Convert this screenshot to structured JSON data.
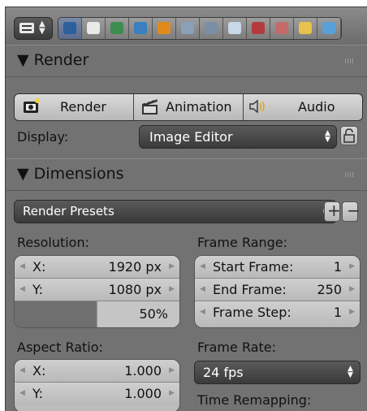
{
  "header": {
    "editor_type_icon": "properties-editor-icon",
    "context_buttons": [
      {
        "icon": "render-camera-icon",
        "active": true,
        "color": "#2d5f9a"
      },
      {
        "icon": "render-layers-icon",
        "active": false,
        "color": "#e9e9e9"
      },
      {
        "icon": "scene-icon",
        "active": false,
        "color": "#3c8d4f"
      },
      {
        "icon": "world-icon",
        "active": false,
        "color": "#3a7fc0"
      },
      {
        "icon": "object-icon",
        "active": false,
        "color": "#e08a1d"
      },
      {
        "icon": "constraints-icon",
        "active": false,
        "color": "#8aa0b8"
      },
      {
        "icon": "modifiers-wrench-icon",
        "active": false,
        "color": "#7a8fa6"
      },
      {
        "icon": "object-data-icon",
        "active": false,
        "color": "#c9d7e6"
      },
      {
        "icon": "material-icon",
        "active": false,
        "color": "#b33b3b"
      },
      {
        "icon": "texture-icon",
        "active": false,
        "color": "#c46a6a"
      },
      {
        "icon": "particles-icon",
        "active": false,
        "color": "#e8c24a"
      },
      {
        "icon": "physics-icon",
        "active": false,
        "color": "#5aa0d8"
      }
    ]
  },
  "render_panel": {
    "title": "Render",
    "buttons": [
      {
        "label": "Render",
        "icon": "render-still-icon"
      },
      {
        "label": "Animation",
        "icon": "clapperboard-icon"
      },
      {
        "label": "Audio",
        "icon": "speaker-icon"
      }
    ],
    "display_label": "Display:",
    "display_value": "Image Editor"
  },
  "dimensions_panel": {
    "title": "Dimensions",
    "presets_value": "Render Presets",
    "resolution_label": "Resolution:",
    "res_x": {
      "key": "X:",
      "value": "1920 px"
    },
    "res_y": {
      "key": "Y:",
      "value": "1080 px"
    },
    "res_percent": {
      "value": "50%",
      "fraction": 0.5
    },
    "frame_range_label": "Frame Range:",
    "start_frame": {
      "key": "Start Frame:",
      "value": "1"
    },
    "end_frame": {
      "key": "End Frame:",
      "value": "250"
    },
    "frame_step": {
      "key": "Frame Step:",
      "value": "1"
    },
    "aspect_label": "Aspect Ratio:",
    "aspect_x": {
      "key": "X:",
      "value": "1.000"
    },
    "aspect_y": {
      "key": "Y:",
      "value": "1.000"
    },
    "frame_rate_label": "Frame Rate:",
    "frame_rate_value": "24 fps",
    "time_remap_label": "Time Remapping:"
  }
}
